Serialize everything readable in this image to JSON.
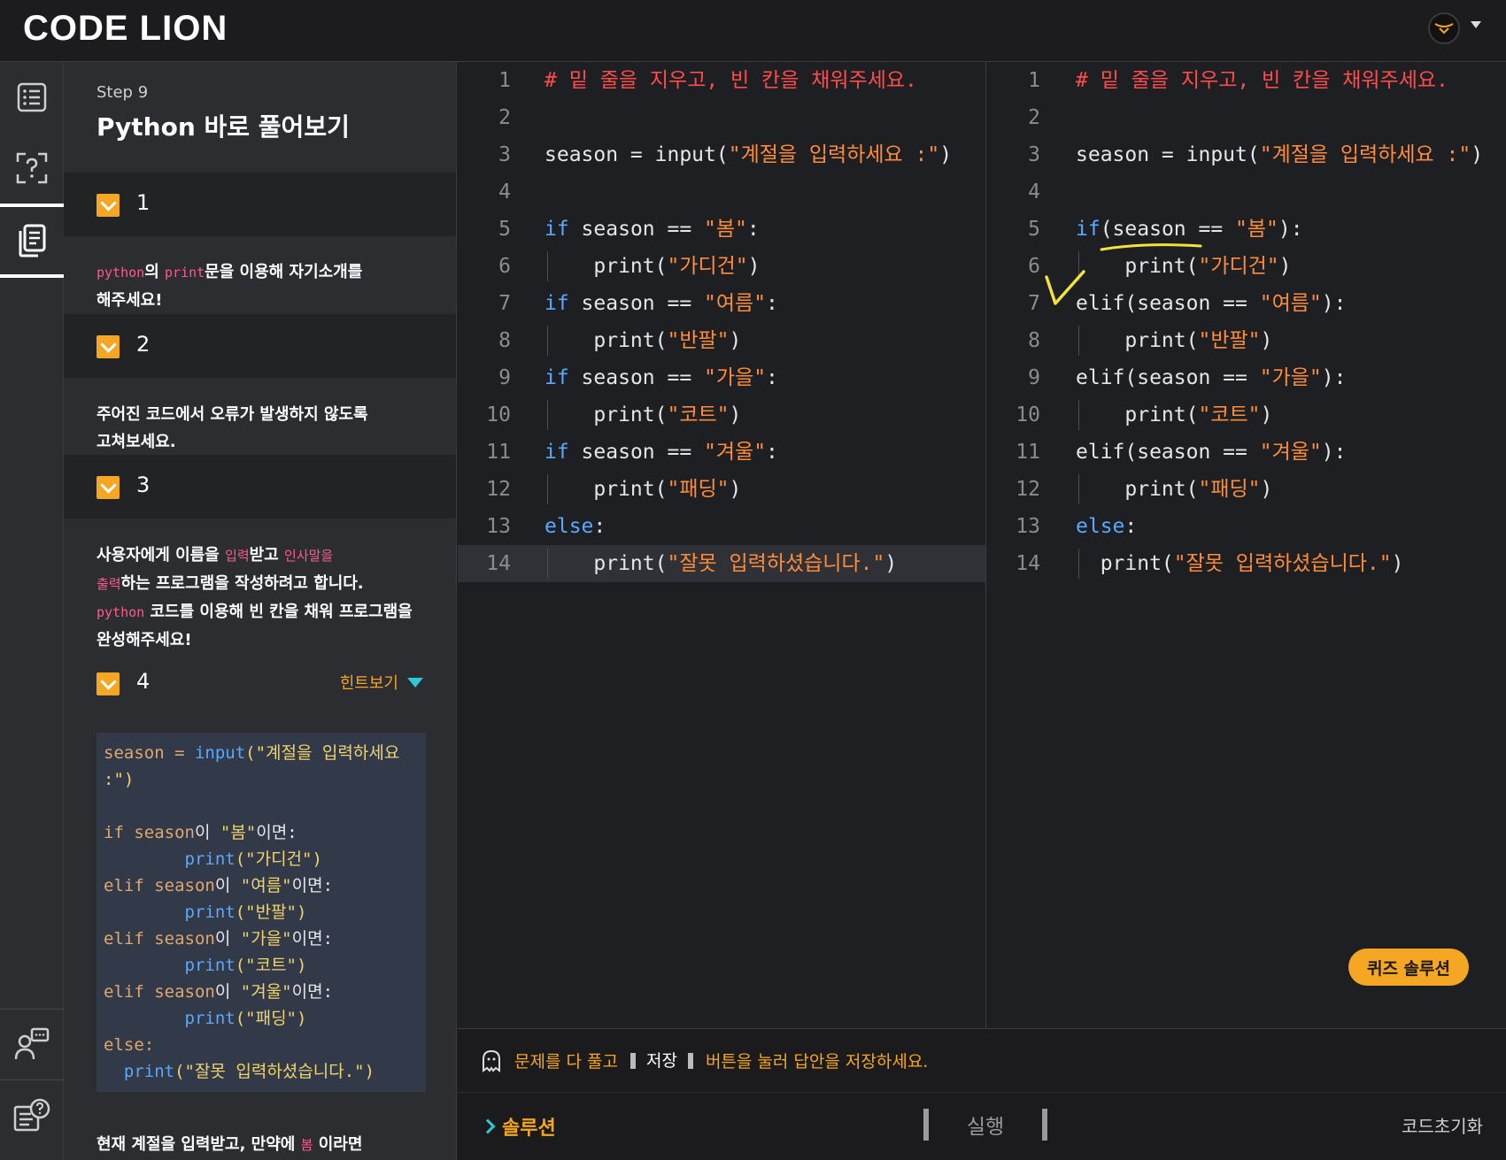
{
  "brand": {
    "logo_text": "CODE LION"
  },
  "header": {
    "avatar": "lion-avatar-icon"
  },
  "rail": {
    "items": [
      {
        "icon": "list-icon",
        "active": false
      },
      {
        "icon": "question-box-icon",
        "active": false
      },
      {
        "icon": "document-icon",
        "active": true
      },
      {
        "icon": "mentor-chat-icon",
        "active": false
      },
      {
        "icon": "help-notebook-icon",
        "active": false
      }
    ]
  },
  "panel": {
    "step_label": "Step 9",
    "title": "Python 바로 풀어보기",
    "tasks": [
      {
        "num": "1"
      },
      {
        "num": "2"
      },
      {
        "num": "3"
      },
      {
        "num": "4"
      }
    ],
    "task1": {
      "hl1": "python",
      "t1": "의 ",
      "hl2": "print",
      "t2": "문을 이용해 자기소개를",
      "t3": "해주세요!"
    },
    "task2": {
      "t1": "주어진 코드에서 오류가 발생하지 않도록",
      "t2": "고쳐보세요."
    },
    "task3": {
      "t1": "사용자에게 이름을 ",
      "hl1": "입력",
      "t2": "받고 ",
      "hl2": "인사말을",
      "hl3": "출력",
      "t3": "하는 프로그램을 작성하려고 합니다.",
      "hl4": "python",
      "t4": " 코드를 이용해 빈 칸을 채워 프로그램을",
      "t5": "완성해주세요!"
    },
    "hint_label": "힌트보기",
    "hint_lines": [
      [
        "season = ",
        "input",
        "(\"계절을 입력하세요"
      ],
      [
        ":\")"
      ],
      [
        ""
      ],
      [
        "if season",
        "이 ",
        "\"봄\"",
        "이면:"
      ],
      [
        "        print",
        "(\"가디건\")"
      ],
      [
        "elif season",
        "이 ",
        "\"여름\"",
        "이면:"
      ],
      [
        "        print",
        "(\"반팔\")"
      ],
      [
        "elif season",
        "이 ",
        "\"가을\"",
        "이면:"
      ],
      [
        "        print",
        "(\"코트\")"
      ],
      [
        "elif season",
        "이 ",
        "\"겨울\"",
        "이면:"
      ],
      [
        "        print",
        "(\"패딩\")"
      ],
      [
        "else:"
      ],
      [
        "  print",
        "(\"잘못 입력하셨습니다.\")"
      ]
    ],
    "footer_text": {
      "t1": "현재 계절을 입력받고, 만약에 ",
      "hl": "봄",
      "t2": " 이라면"
    }
  },
  "editor_left": {
    "lines": [
      {
        "n": "1",
        "parts": [
          [
            "c-comment",
            "# 밑 줄을 지우고, 빈 칸을 채워주세요."
          ]
        ]
      },
      {
        "n": "2",
        "parts": []
      },
      {
        "n": "3",
        "parts": [
          [
            "c-plain",
            "season = input("
          ],
          [
            "c-str",
            "\"계절을 입력하세요 :\""
          ],
          [
            "c-plain",
            ")"
          ]
        ]
      },
      {
        "n": "4",
        "parts": []
      },
      {
        "n": "5",
        "parts": [
          [
            "c-kw",
            "if"
          ],
          [
            "c-plain",
            " season == "
          ],
          [
            "c-str",
            "\"봄\""
          ],
          [
            "c-plain",
            ":"
          ]
        ]
      },
      {
        "n": "6",
        "parts": [
          [
            "c-plain",
            "    print("
          ],
          [
            "c-str",
            "\"가디건\""
          ],
          [
            "c-plain",
            ")"
          ]
        ]
      },
      {
        "n": "7",
        "parts": [
          [
            "c-kw",
            "if"
          ],
          [
            "c-plain",
            " season == "
          ],
          [
            "c-str",
            "\"여름\""
          ],
          [
            "c-plain",
            ":"
          ]
        ]
      },
      {
        "n": "8",
        "parts": [
          [
            "c-plain",
            "    print("
          ],
          [
            "c-str",
            "\"반팔\""
          ],
          [
            "c-plain",
            ")"
          ]
        ]
      },
      {
        "n": "9",
        "parts": [
          [
            "c-kw",
            "if"
          ],
          [
            "c-plain",
            " season == "
          ],
          [
            "c-str",
            "\"가을\""
          ],
          [
            "c-plain",
            ":"
          ]
        ]
      },
      {
        "n": "10",
        "parts": [
          [
            "c-plain",
            "    print("
          ],
          [
            "c-str",
            "\"코트\""
          ],
          [
            "c-plain",
            ")"
          ]
        ]
      },
      {
        "n": "11",
        "parts": [
          [
            "c-kw",
            "if"
          ],
          [
            "c-plain",
            " season == "
          ],
          [
            "c-str",
            "\"겨울\""
          ],
          [
            "c-plain",
            ":"
          ]
        ]
      },
      {
        "n": "12",
        "parts": [
          [
            "c-plain",
            "    print("
          ],
          [
            "c-str",
            "\"패딩\""
          ],
          [
            "c-plain",
            ")"
          ]
        ]
      },
      {
        "n": "13",
        "parts": [
          [
            "c-kw",
            "else"
          ],
          [
            "c-plain",
            ":"
          ]
        ]
      },
      {
        "n": "14",
        "parts": [
          [
            "c-plain",
            "    print("
          ],
          [
            "c-str",
            "\"잘못 입력하셨습니다.\""
          ],
          [
            "c-plain",
            ")"
          ]
        ]
      }
    ]
  },
  "editor_right": {
    "lines": [
      {
        "n": "1",
        "parts": [
          [
            "c-comment",
            "# 밑 줄을 지우고, 빈 칸을 채워주세요."
          ]
        ]
      },
      {
        "n": "2",
        "parts": []
      },
      {
        "n": "3",
        "parts": [
          [
            "c-plain",
            "season = input("
          ],
          [
            "c-str",
            "\"계절을 입력하세요 :\""
          ],
          [
            "c-plain",
            ")"
          ]
        ]
      },
      {
        "n": "4",
        "parts": []
      },
      {
        "n": "5",
        "parts": [
          [
            "c-kw",
            "if"
          ],
          [
            "c-plain",
            "(season == "
          ],
          [
            "c-str",
            "\"봄\""
          ],
          [
            "c-plain",
            "):"
          ]
        ]
      },
      {
        "n": "6",
        "parts": [
          [
            "c-plain",
            "    print("
          ],
          [
            "c-str",
            "\"가디건\""
          ],
          [
            "c-plain",
            ")"
          ]
        ]
      },
      {
        "n": "7",
        "parts": [
          [
            "c-plain",
            "elif(season == "
          ],
          [
            "c-str",
            "\"여름\""
          ],
          [
            "c-plain",
            "):"
          ]
        ]
      },
      {
        "n": "8",
        "parts": [
          [
            "c-plain",
            "    print("
          ],
          [
            "c-str",
            "\"반팔\""
          ],
          [
            "c-plain",
            ")"
          ]
        ]
      },
      {
        "n": "9",
        "parts": [
          [
            "c-plain",
            "elif(season == "
          ],
          [
            "c-str",
            "\"가을\""
          ],
          [
            "c-plain",
            "):"
          ]
        ]
      },
      {
        "n": "10",
        "parts": [
          [
            "c-plain",
            "    print("
          ],
          [
            "c-str",
            "\"코트\""
          ],
          [
            "c-plain",
            ")"
          ]
        ]
      },
      {
        "n": "11",
        "parts": [
          [
            "c-plain",
            "elif(season == "
          ],
          [
            "c-str",
            "\"겨울\""
          ],
          [
            "c-plain",
            "):"
          ]
        ]
      },
      {
        "n": "12",
        "parts": [
          [
            "c-plain",
            "    print("
          ],
          [
            "c-str",
            "\"패딩\""
          ],
          [
            "c-plain",
            ")"
          ]
        ]
      },
      {
        "n": "13",
        "parts": [
          [
            "c-kw",
            "else"
          ],
          [
            "c-plain",
            ":"
          ]
        ]
      },
      {
        "n": "14",
        "parts": [
          [
            "c-plain",
            "  print("
          ],
          [
            "c-str",
            "\"잘못 입력하셨습니다.\""
          ],
          [
            "c-plain",
            ")"
          ]
        ]
      }
    ]
  },
  "quiz_solution_label": "퀴즈 솔루션",
  "save_bar": {
    "msg_a": "문제를 다 풀고",
    "msg_b": "저장",
    "msg_c": "버튼을 눌러 답안을 저장하세요."
  },
  "bottom": {
    "solution_label": "솔루션",
    "run_label": "실행",
    "reset_label": "코드초기화"
  },
  "colors": {
    "accent": "#f5a623",
    "highlight": "#ff5a8a",
    "code_keyword": "#5aa8ff",
    "code_string": "#ff8c3a",
    "code_comment": "#ff4b4b"
  }
}
